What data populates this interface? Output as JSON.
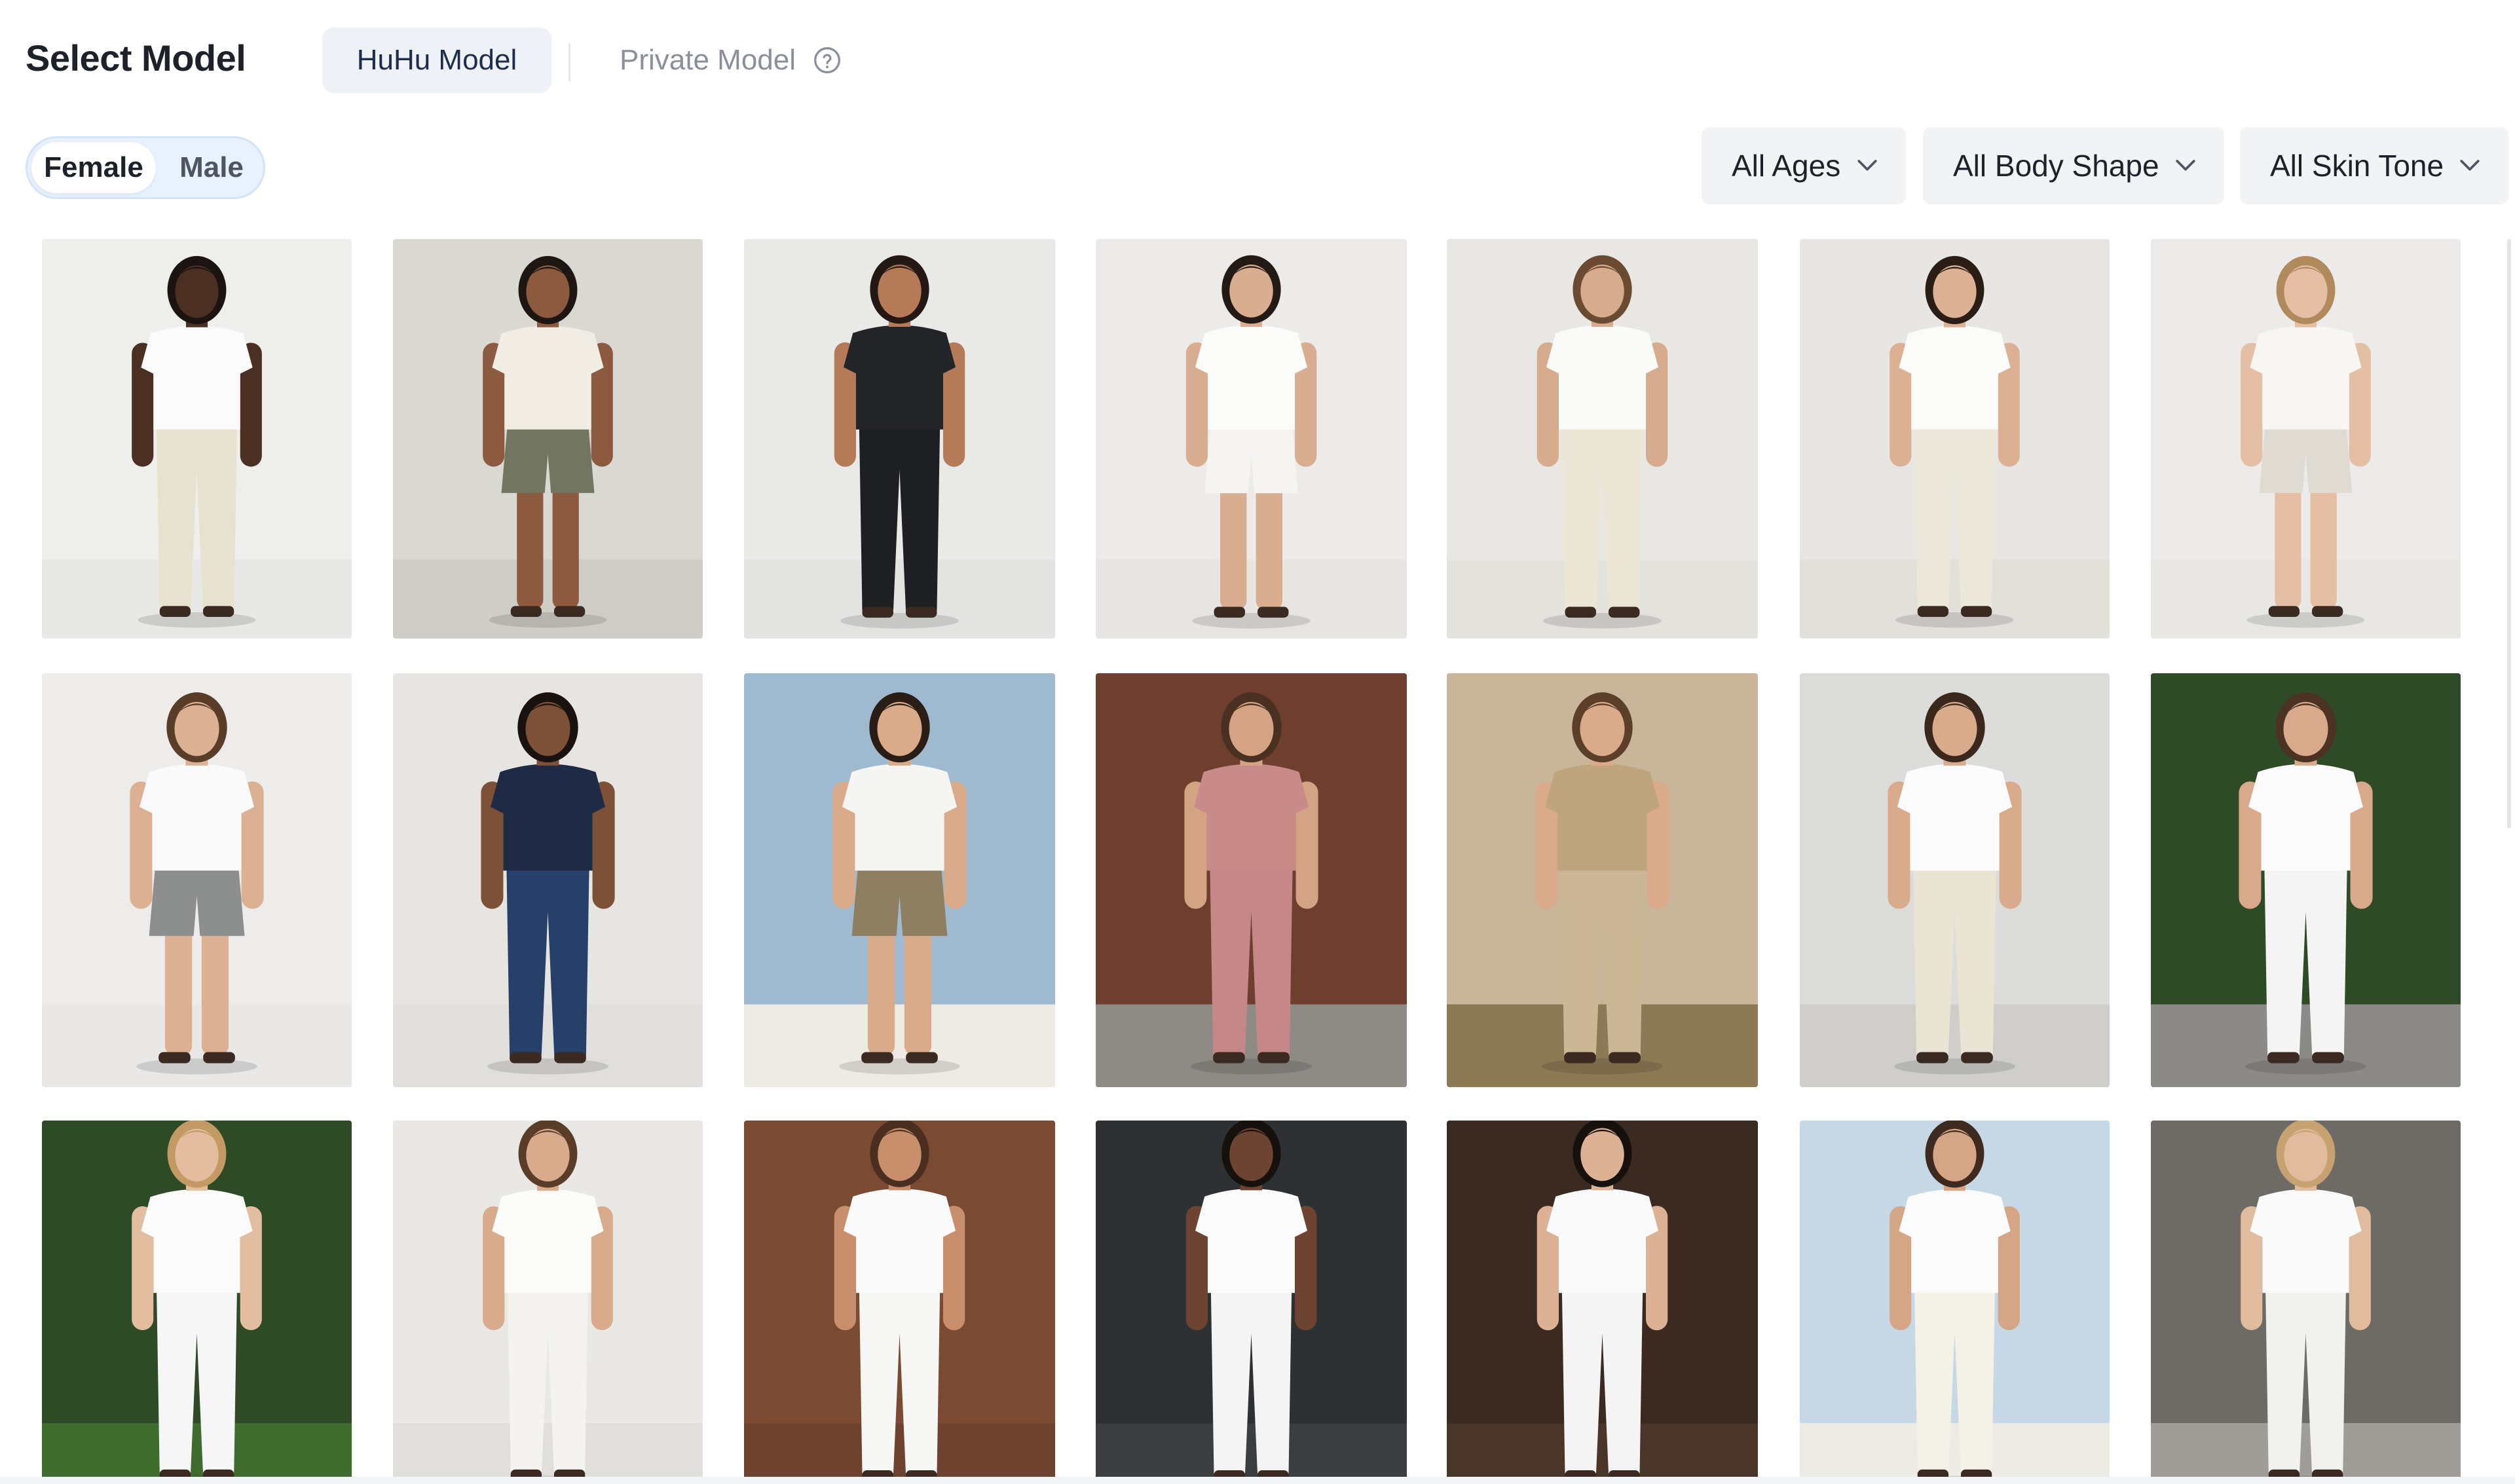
{
  "header": {
    "title": "Select Model",
    "tabs": [
      {
        "label": "HuHu Model",
        "active": true
      },
      {
        "label": "Private Model",
        "active": false
      }
    ]
  },
  "filters": {
    "gender": {
      "options": [
        "Female",
        "Male"
      ],
      "selected": "Female"
    },
    "age": "All Ages",
    "body_shape": "All Body Shape",
    "skin_tone": "All Skin Tone"
  },
  "colors": {
    "active_tab_bg": "#eef1f5",
    "toggle_bg": "#e8f1fe",
    "select_bg": "#f2f3f5",
    "title_text": "#1d2129",
    "muted_text": "#8a9099"
  },
  "models": [
    {
      "bg": "#eeeeec",
      "top": "#fbfbfb",
      "bottom": "#e7e1cf",
      "skin": "#4a2f22",
      "hair": "#1b1411",
      "floor": "#e8e8e6",
      "shorts": false
    },
    {
      "bg": "#d9d8d3",
      "top": "#f1ede5",
      "bottom": "#727660",
      "skin": "#8c5a3f",
      "hair": "#1d1612",
      "floor": "#cfcdc7",
      "shorts": true
    },
    {
      "bg": "#e9e9e8",
      "top": "#232427",
      "bottom": "#1e1f22",
      "skin": "#b57a57",
      "hair": "#231814",
      "floor": "#e3e3e2",
      "shorts": false
    },
    {
      "bg": "#ecebea",
      "top": "#fbfbfa",
      "bottom": "#f5f4f2",
      "skin": "#d9ad8f",
      "hair": "#241a15",
      "floor": "#e7e5e2",
      "shorts": true
    },
    {
      "bg": "#e8e7e3",
      "top": "#fafaf8",
      "bottom": "#ebe6d6",
      "skin": "#d7ab8d",
      "hair": "#6b4a32",
      "floor": "#e4e2dd",
      "shorts": false
    },
    {
      "bg": "#e7e6e2",
      "top": "#fbfbfa",
      "bottom": "#ece8d9",
      "skin": "#dcb193",
      "hair": "#2a1d16",
      "floor": "#e2e0db",
      "shorts": false
    },
    {
      "bg": "#ecebe9",
      "top": "#f7f6f3",
      "bottom": "#e0dbd2",
      "skin": "#e4bfa4",
      "hair": "#b08a5c",
      "floor": "#e8e7e4",
      "shorts": true
    },
    {
      "bg": "#edeceb",
      "top": "#fafafa",
      "bottom": "#8d8e8e",
      "skin": "#dcb092",
      "hair": "#5a3d29",
      "floor": "#e9e8e7",
      "shorts": true
    },
    {
      "bg": "#e6e5e2",
      "top": "#1f2a44",
      "bottom": "#27406a",
      "skin": "#7d5038",
      "hair": "#1a120e",
      "floor": "#e0dfdb",
      "shorts": false
    },
    {
      "bg": "#9fb9cf",
      "top": "#f5f5f4",
      "bottom": "#8f7f62",
      "skin": "#d9ab8b",
      "hair": "#2a1d16",
      "floor": "#eeeae4",
      "shorts": true
    },
    {
      "bg": "#6e3f2f",
      "top": "#c98a8a",
      "bottom": "#c58787",
      "skin": "#d4a384",
      "hair": "#4a3021",
      "floor": "#8e8a86",
      "shorts": false
    },
    {
      "bg": "#c9b59a",
      "top": "#bfa57d",
      "bottom": "#cbb796",
      "skin": "#d9ab8b",
      "hair": "#5b3f2b",
      "floor": "#8c7a55",
      "shorts": false
    },
    {
      "bg": "#dcdcda",
      "top": "#fbfbfb",
      "bottom": "#e9e4d3",
      "skin": "#d8ab8c",
      "hair": "#3a281d",
      "floor": "#cfceca",
      "shorts": false
    },
    {
      "bg": "#2f4a26",
      "top": "#fbfbfb",
      "bottom": "#f4f4f4",
      "skin": "#d8a98a",
      "hair": "#4b3223",
      "floor": "#8c8a86",
      "shorts": false
    },
    {
      "bg": "#2e4a26",
      "top": "#fbfbfb",
      "bottom": "#f6f6f6",
      "skin": "#e2bd9f",
      "hair": "#c39a63",
      "floor": "#3f6b2e",
      "shorts": false
    },
    {
      "bg": "#e9e8e4",
      "top": "#fbfbfa",
      "bottom": "#f4f3ef",
      "skin": "#d8ab8c",
      "hair": "#5a3d29",
      "floor": "#e0dfdb",
      "shorts": false
    },
    {
      "bg": "#7a4a33",
      "top": "#fafafa",
      "bottom": "#f6f6f5",
      "skin": "#c98f6c",
      "hair": "#4a2f20",
      "floor": "#6d4330",
      "shorts": false
    },
    {
      "bg": "#2d3134",
      "top": "#fbfbfb",
      "bottom": "#f4f4f4",
      "skin": "#6d4431",
      "hair": "#17110e",
      "floor": "#3a3e41",
      "shorts": false
    },
    {
      "bg": "#3b2a22",
      "top": "#fafafa",
      "bottom": "#f4f4f4",
      "skin": "#dcb194",
      "hair": "#17110e",
      "floor": "#4a3529",
      "shorts": false
    },
    {
      "bg": "#c6d7e6",
      "top": "#fbfbfb",
      "bottom": "#f4f1e6",
      "skin": "#d5a686",
      "hair": "#3e2a1f",
      "floor": "#ecebe6",
      "shorts": false
    },
    {
      "bg": "#6e6b66",
      "top": "#fafafa",
      "bottom": "#f1f1f0",
      "skin": "#e0bb9e",
      "hair": "#c7a270",
      "floor": "#a09d98",
      "shorts": false
    }
  ]
}
